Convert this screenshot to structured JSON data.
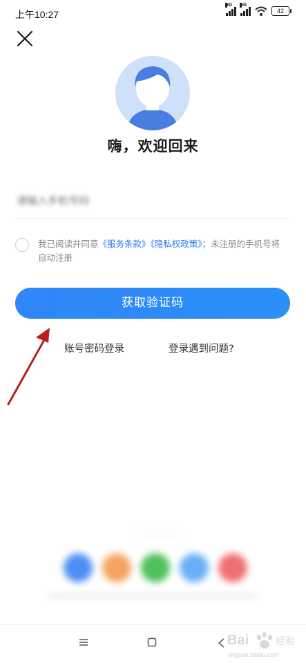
{
  "status_bar": {
    "time": "上午10:27",
    "network_label": "HD",
    "battery": "42"
  },
  "header": {
    "close_icon": "close-icon"
  },
  "welcome": {
    "title": "嗨，欢迎回来"
  },
  "login_form": {
    "phone_placeholder": "请输入手机号码",
    "agreement": {
      "prefix": "我已阅读并同意",
      "terms_link": "《服务条款》",
      "privacy_link": "《隐私权政策》",
      "suffix": "；未注册的手机号将自动注册"
    },
    "submit_label": "获取验证码",
    "account_login_label": "账号密码登录",
    "help_label": "登录遇到问题?"
  },
  "colors": {
    "accent": "#2f86f8",
    "link": "#2d7cf6",
    "annotation_arrow": "#b51f1f"
  },
  "watermark": {
    "brand": "Bai",
    "brand_cn": "经验",
    "url": "jingyan.baidu.com"
  }
}
